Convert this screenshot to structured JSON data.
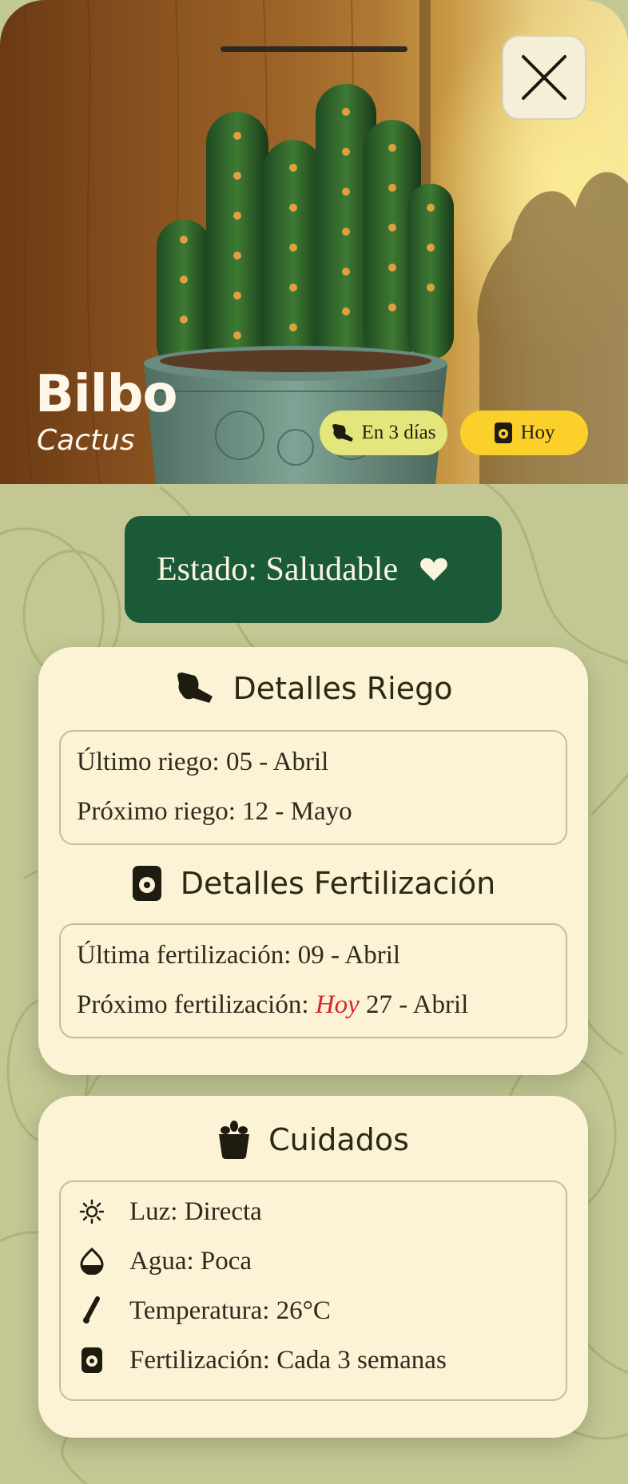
{
  "plant": {
    "name": "Bilbo",
    "species": "Cactus"
  },
  "chips": {
    "water": "En 3 días",
    "fertilize": "Hoy"
  },
  "status": {
    "label": "Estado: Saludable"
  },
  "watering": {
    "title": "Detalles Riego",
    "last": "Último riego: 05 - Abril",
    "next": "Próximo riego: 12 - Mayo"
  },
  "fertilization": {
    "title": "Detalles Fertilización",
    "last": "Última fertilización: 09 - Abril",
    "next_prefix": "Próximo fertilización: ",
    "next_today": "Hoy",
    "next_date": " 27 - Abril"
  },
  "care": {
    "title": "Cuidados",
    "items": [
      {
        "label": "Luz: Directa",
        "icon": "sun-icon"
      },
      {
        "label": "Agua: Poca",
        "icon": "water-drop-icon"
      },
      {
        "label": "Temperatura: 26°C",
        "icon": "thermometer-icon"
      },
      {
        "label": "Fertilización: Cada 3 semanas",
        "icon": "fertilizer-bag-icon"
      }
    ]
  },
  "colors": {
    "status_bg": "#1a5a38",
    "card_bg": "#fcf3d6",
    "page_bg": "#c3c794",
    "chip_water": "#e4e57a",
    "chip_fert": "#fcd02a",
    "today_accent": "#d7262a"
  }
}
